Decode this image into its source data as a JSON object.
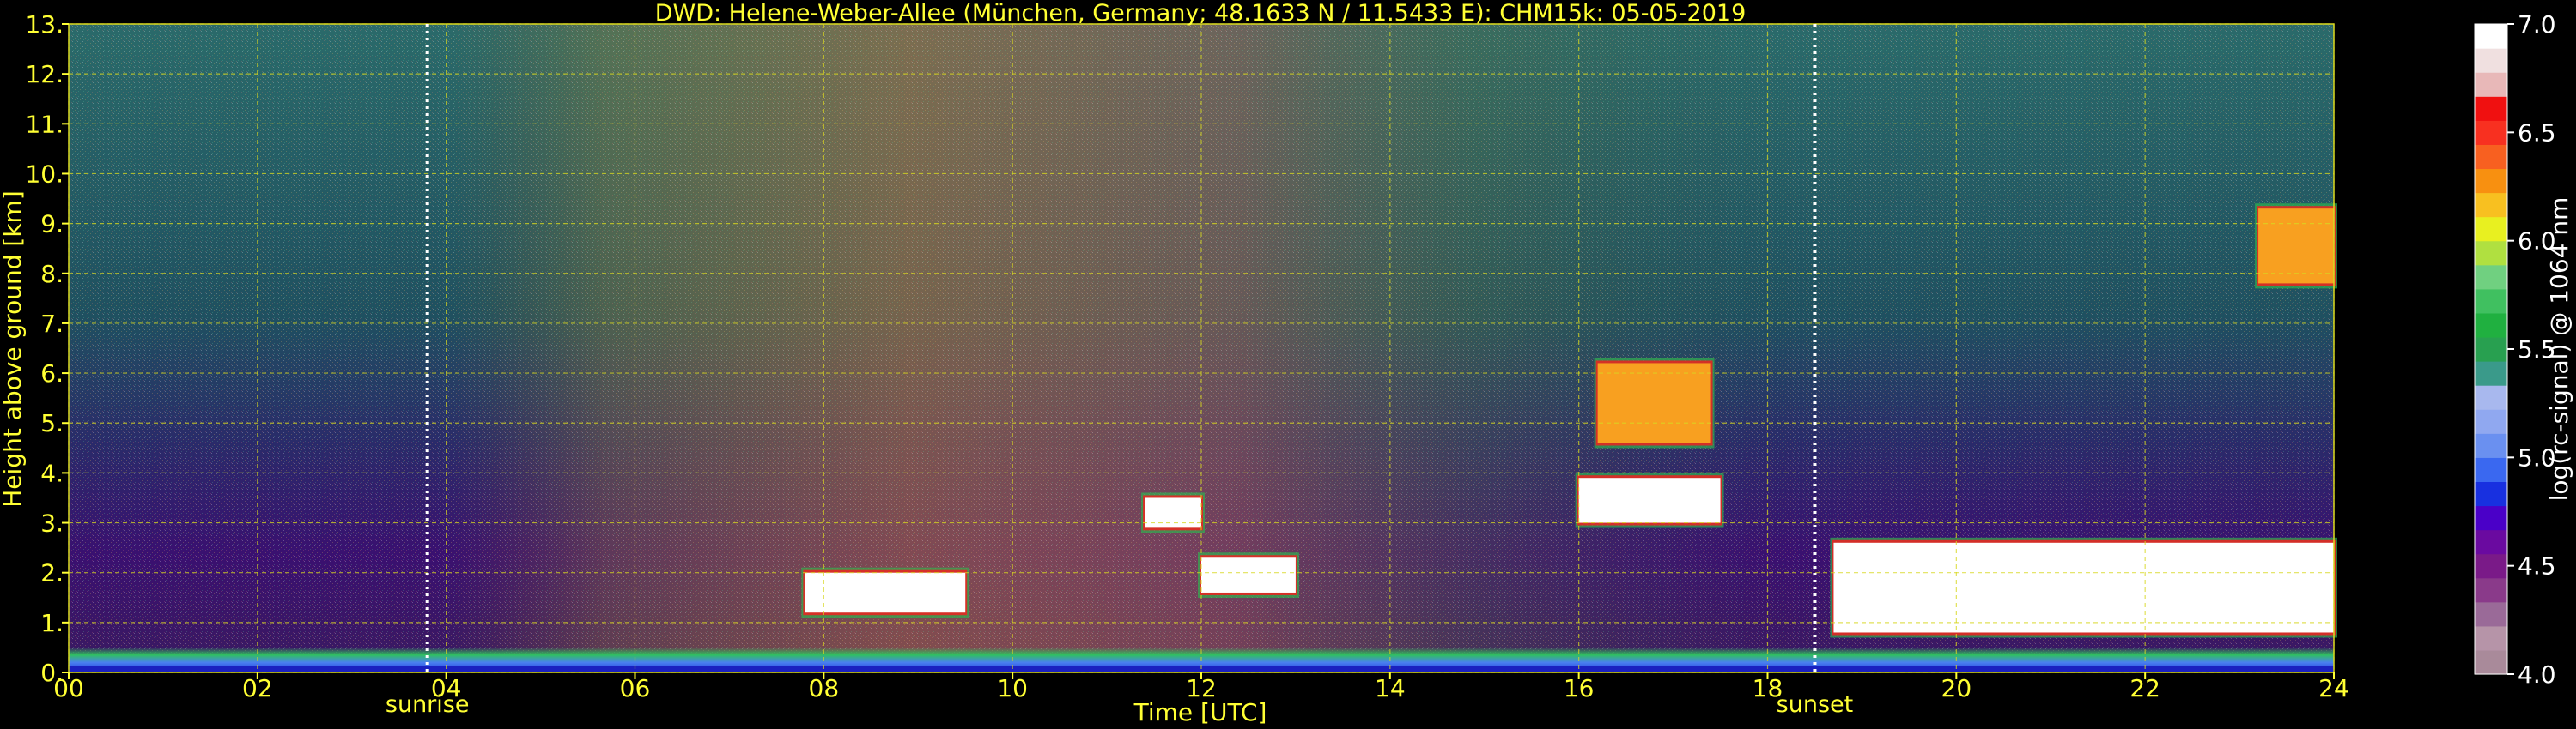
{
  "chart_data": {
    "type": "heatmap",
    "title": "DWD: Helene-Weber-Allee (München, Germany; 48.1633 N / 11.5433 E):    CHM15k: 05-05-2019",
    "xlabel": "Time [UTC]",
    "ylabel": "Height above ground [km]",
    "colorbar_label": "log(rc-signal) @ 1064 nm",
    "xlim": [
      0,
      24
    ],
    "ylim": [
      0,
      13
    ],
    "x_ticks": [
      "00",
      "02",
      "04",
      "06",
      "08",
      "10",
      "12",
      "14",
      "16",
      "18",
      "20",
      "22",
      "24"
    ],
    "y_ticks": [
      "0.",
      "1.",
      "2.",
      "3.",
      "4.",
      "5.",
      "6.",
      "7.",
      "8.",
      "9.",
      "10.",
      "11.",
      "12.",
      "13."
    ],
    "colorbar_range": [
      4.0,
      7.0
    ],
    "colorbar_ticks": [
      "4.0",
      "4.5",
      "5.0",
      "5.5",
      "6.0",
      "6.5",
      "7.0"
    ],
    "colorbar_colors": [
      "#a98a9a",
      "#b694a8",
      "#9a6a98",
      "#8a3a8a",
      "#7a1a88",
      "#6a0aa0",
      "#4a00c8",
      "#1830e0",
      "#3a68f0",
      "#6a90f0",
      "#90a8f0",
      "#a8b8ee",
      "#3a9a8a",
      "#28a050",
      "#20b040",
      "#40c060",
      "#70d080",
      "#b0e040",
      "#e8f020",
      "#f8c020",
      "#f89010",
      "#f86020",
      "#f83020",
      "#f01010",
      "#e8b8b8",
      "#f0e0e0",
      "#ffffff"
    ],
    "grid": true,
    "markers": [
      {
        "name": "sunrise",
        "time": 3.8
      },
      {
        "name": "sunset",
        "time": 18.5
      }
    ],
    "cloud_layers": [
      {
        "t0": 7.8,
        "t1": 9.5,
        "h0": 1.2,
        "h1": 2.0,
        "level": "high"
      },
      {
        "t0": 11.4,
        "t1": 12.0,
        "h0": 2.9,
        "h1": 3.5,
        "level": "high"
      },
      {
        "t0": 12.0,
        "t1": 13.0,
        "h0": 1.6,
        "h1": 2.3,
        "level": "high"
      },
      {
        "t0": 16.0,
        "t1": 17.5,
        "h0": 3.0,
        "h1": 3.9,
        "level": "high"
      },
      {
        "t0": 16.2,
        "t1": 17.4,
        "h0": 4.6,
        "h1": 6.2,
        "level": "mid"
      },
      {
        "t0": 18.7,
        "t1": 24.0,
        "h0": 0.8,
        "h1": 2.6,
        "level": "high"
      },
      {
        "t0": 23.2,
        "t1": 24.0,
        "h0": 7.8,
        "h1": 9.3,
        "level": "mid"
      }
    ]
  }
}
